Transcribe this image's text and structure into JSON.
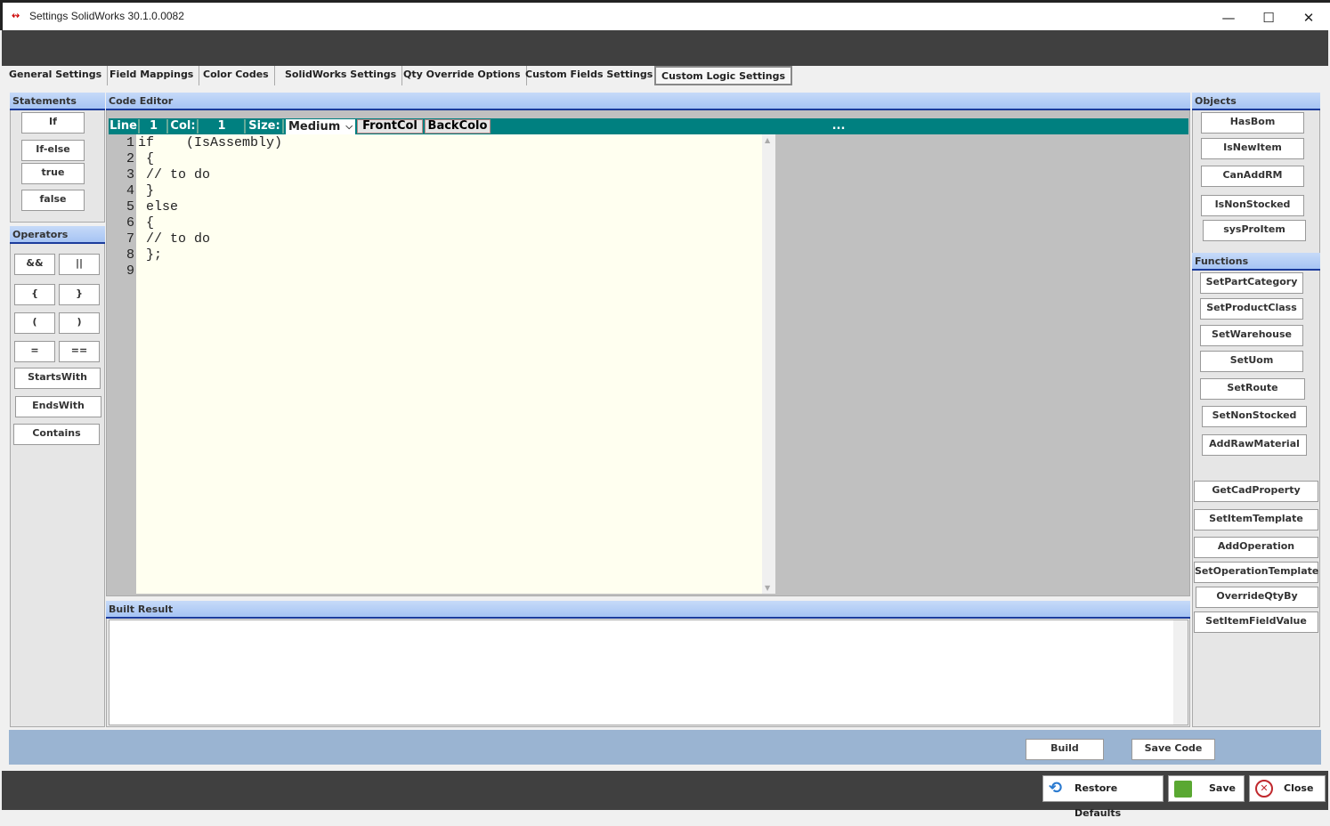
{
  "window": {
    "title": "Settings SolidWorks 30.1.0.0082",
    "minimize": "—",
    "maximize": "☐",
    "close": "✕"
  },
  "tabs": [
    "General Settings",
    "Field Mappings",
    "Color Codes",
    "SolidWorks Settings",
    "Qty Override Options",
    "Custom Fields Settings",
    "Custom Logic Settings"
  ],
  "statements": {
    "header": "Statements",
    "items": [
      "If",
      "If-else",
      "true",
      "false"
    ]
  },
  "operators": {
    "header": "Operators",
    "items": [
      "&&",
      "||",
      "{",
      "}",
      "(",
      ")",
      "=",
      "==",
      "StartsWith",
      "EndsWith",
      "Contains"
    ]
  },
  "editor": {
    "header": "Code Editor",
    "line_label": "Line",
    "line": "1",
    "col_label": "Col:",
    "col": "1",
    "size_label": "Size:",
    "size": "Medium",
    "front_col": "FrontCol",
    "back_col": "BackColo",
    "more": "...",
    "lines": [
      "if    (IsAssembly)",
      " {",
      " // to do",
      " }",
      " else",
      " {",
      " // to do",
      " };",
      ""
    ]
  },
  "built": {
    "header": "Built Result",
    "value": ""
  },
  "objects": {
    "header": "Objects",
    "items": [
      "HasBom",
      "IsNewItem",
      "CanAddRM",
      "IsNonStocked",
      "sysProItem"
    ]
  },
  "functions": {
    "header": "Functions",
    "items": [
      "SetPartCategory",
      "SetProductClass",
      "SetWarehouse",
      "SetUom",
      "SetRoute",
      "SetNonStocked",
      "AddRawMaterial",
      "GetCadProperty",
      "SetItemTemplate",
      "AddOperation",
      "SetOperationTemplate",
      "OverrideQtyBy",
      "SetItemFieldValue"
    ]
  },
  "actions": {
    "build": "Build",
    "save_code": "Save Code"
  },
  "footer": {
    "restore": "Restore Defaults",
    "save": "Save",
    "close": "Close"
  }
}
